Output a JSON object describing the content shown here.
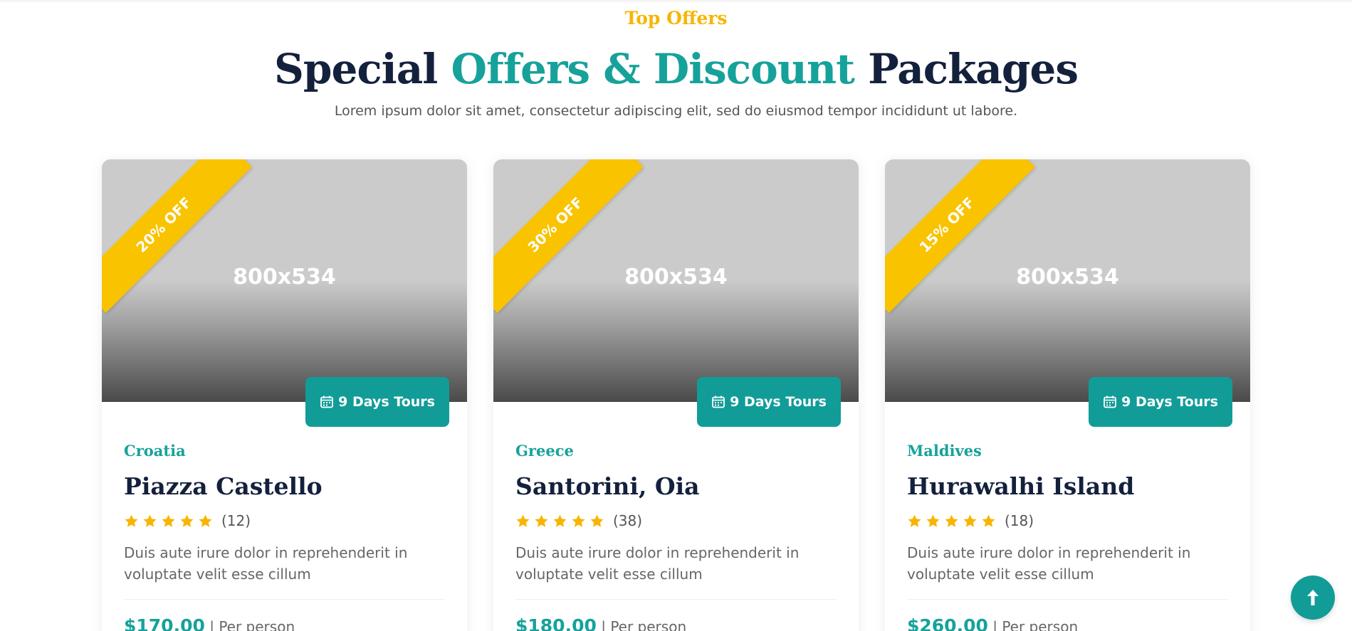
{
  "header": {
    "eyebrow": "Top Offers",
    "title_part1": "Special",
    "title_accent": "Offers & Discount",
    "title_part2": "Packages",
    "subtitle": "Lorem ipsum dolor sit amet, consectetur adipiscing elit, sed do eiusmod tempor incididunt ut labore."
  },
  "cards": [
    {
      "discount": "20% OFF",
      "image_label": "800x534",
      "duration": "9 Days Tours",
      "country": "Croatia",
      "place": "Piazza Castello",
      "rating_count": "(12)",
      "description": "Duis aute irure dolor in reprehenderit in voluptate velit esse cillum",
      "price": "$170.00",
      "per": " | Per person"
    },
    {
      "discount": "30% OFF",
      "image_label": "800x534",
      "duration": "9 Days Tours",
      "country": "Greece",
      "place": "Santorini, Oia",
      "rating_count": "(38)",
      "description": "Duis aute irure dolor in reprehenderit in voluptate velit esse cillum",
      "price": "$180.00",
      "per": " | Per person"
    },
    {
      "discount": "15% OFF",
      "image_label": "800x534",
      "duration": "9 Days Tours",
      "country": "Maldives",
      "place": "Hurawalhi Island",
      "rating_count": "(18)",
      "description": "Duis aute irure dolor in reprehenderit in voluptate velit esse cillum",
      "price": "$260.00",
      "per": " | Per person"
    }
  ],
  "rating_stars": 5,
  "colors": {
    "accent": "#16a29a",
    "badge": "#129c98",
    "ribbon": "#f9c300",
    "star": "#f7b500",
    "heading": "#14213d"
  },
  "icons": {
    "calendar": "calendar-icon",
    "star": "star-icon",
    "back_to_top": "arrow-up-icon"
  }
}
